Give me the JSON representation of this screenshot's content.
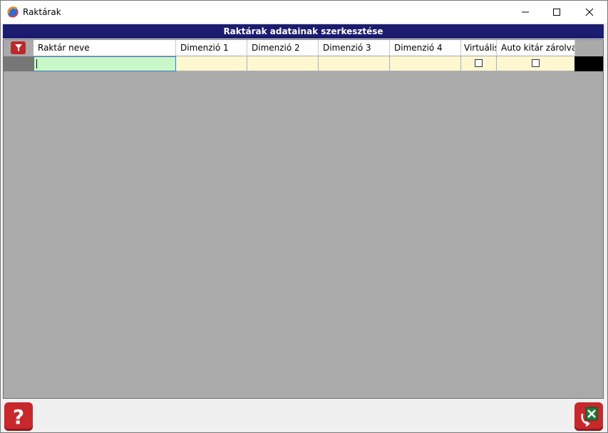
{
  "window": {
    "title": "Raktárak"
  },
  "header": {
    "title": "Raktárak adatainak szerkesztése"
  },
  "grid": {
    "columns": [
      "Raktár neve",
      "Dimenzió 1",
      "Dimenzió 2",
      "Dimenzió 3",
      "Dimenzió 4",
      "Virtuális",
      "Auto kitár zárolva"
    ],
    "row": {
      "raktar_neve": "",
      "dimenzio1": "",
      "dimenzio2": "",
      "dimenzio3": "",
      "dimenzio4": "",
      "virtualis": false,
      "auto_kitar_zarolva": false
    }
  },
  "icons": {
    "app": "app-icon",
    "filter": "filter-icon",
    "help": "help-icon",
    "export": "excel-export-icon",
    "minimize": "minimize-icon",
    "maximize": "maximize-icon",
    "close": "close-icon"
  },
  "colors": {
    "header_bg": "#1b1b6f",
    "grid_bg": "#aaaaaa",
    "active_cell": "#c8f7c8",
    "edit_cell": "#fff7d0",
    "accent_red": "#c8282c"
  }
}
